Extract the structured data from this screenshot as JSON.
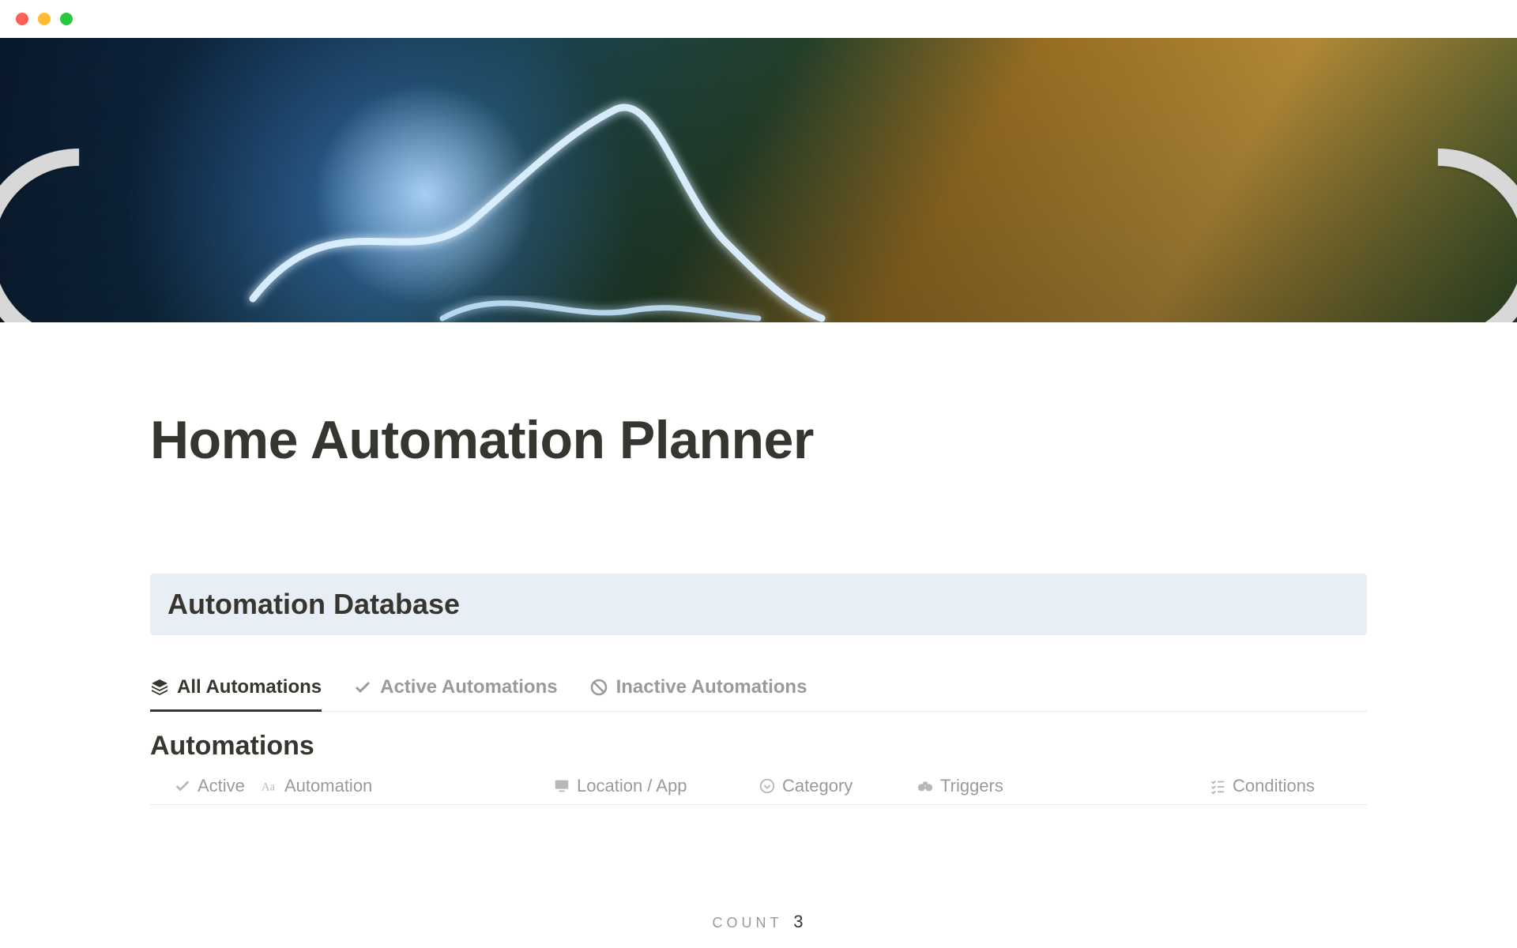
{
  "page": {
    "title": "Home Automation Planner"
  },
  "callout": {
    "heading": "Automation Database"
  },
  "tabs": [
    {
      "label": "All Automations",
      "active": true
    },
    {
      "label": "Active Automations",
      "active": false
    },
    {
      "label": "Inactive Automations",
      "active": false
    }
  ],
  "table": {
    "title": "Automations",
    "columns": {
      "active": "Active",
      "automation": "Automation",
      "location": "Location / App",
      "category": "Category",
      "triggers": "Triggers",
      "conditions": "Conditions"
    }
  },
  "footer": {
    "count_label": "COUNT",
    "count_value": "3"
  }
}
